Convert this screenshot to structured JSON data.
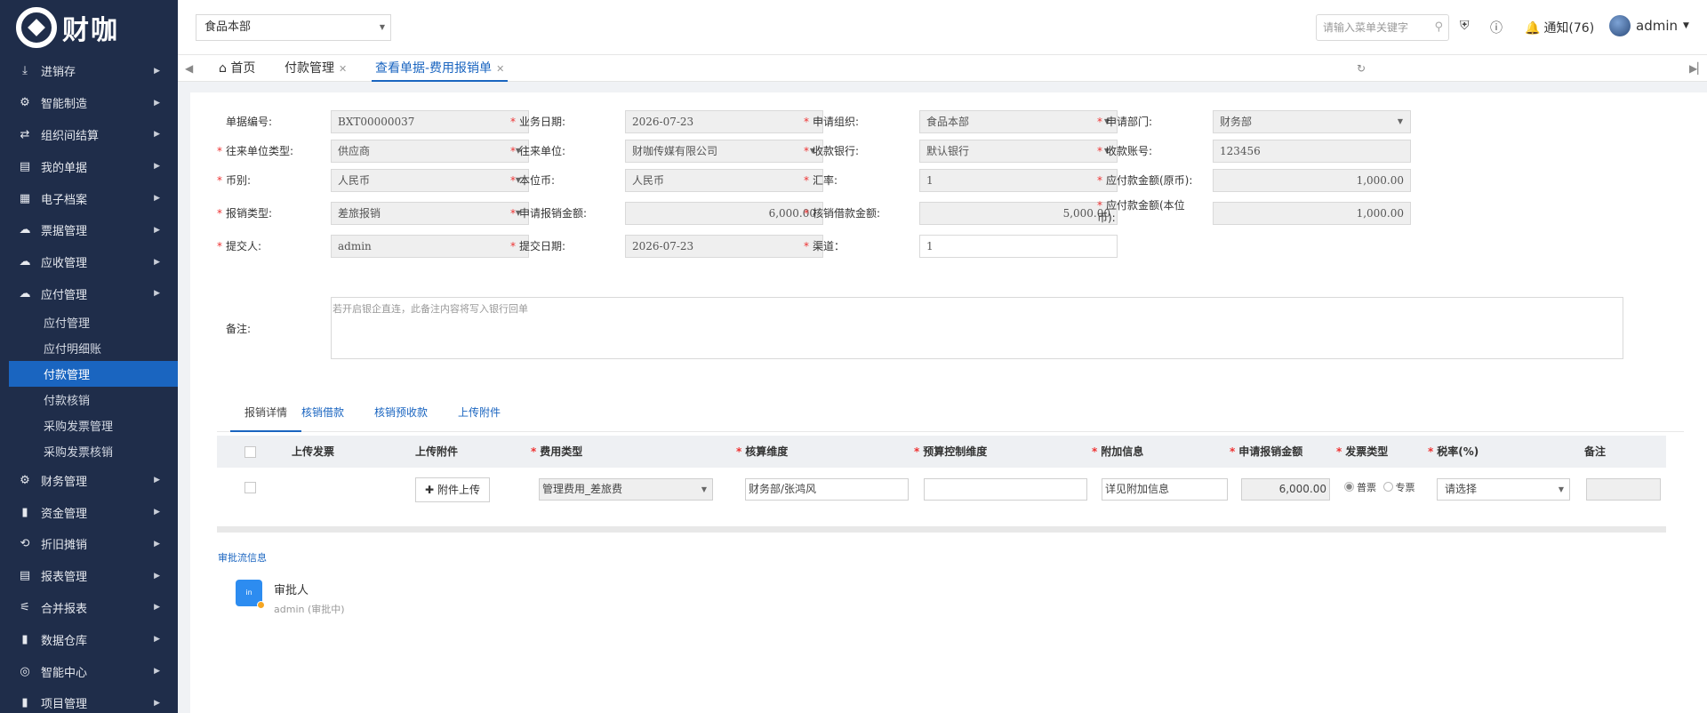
{
  "brand": {
    "name": "财咖"
  },
  "sidebar": {
    "items": [
      {
        "label": "进销存",
        "icon": "download-icon"
      },
      {
        "label": "智能制造",
        "icon": "gears-icon"
      },
      {
        "label": "组织间结算",
        "icon": "exchange-icon"
      },
      {
        "label": "我的单据",
        "icon": "document-icon"
      },
      {
        "label": "电子档案",
        "icon": "archive-icon"
      },
      {
        "label": "票据管理",
        "icon": "cloud-upload-icon"
      },
      {
        "label": "应收管理",
        "icon": "cloud-upload-icon"
      },
      {
        "label": "应付管理",
        "icon": "cloud-download-icon"
      }
    ],
    "sub_items": [
      {
        "label": "应付管理"
      },
      {
        "label": "应付明细账"
      },
      {
        "label": "付款管理"
      },
      {
        "label": "付款核销"
      },
      {
        "label": "采购发票管理"
      },
      {
        "label": "采购发票核销"
      }
    ],
    "items_after": [
      {
        "label": "财务管理",
        "icon": "gear-icon"
      },
      {
        "label": "资金管理",
        "icon": "bar-chart-icon"
      },
      {
        "label": "折旧摊销",
        "icon": "repeat-icon"
      },
      {
        "label": "报表管理",
        "icon": "report-icon"
      },
      {
        "label": "合并报表",
        "icon": "merge-icon"
      },
      {
        "label": "数据仓库",
        "icon": "bar-chart-icon"
      },
      {
        "label": "智能中心",
        "icon": "globe-icon"
      },
      {
        "label": "项目管理",
        "icon": "bar-chart-icon"
      }
    ]
  },
  "header": {
    "org": "食品本部",
    "search_placeholder": "请输入菜单关键字",
    "notice": "通知(76)",
    "user": "admin"
  },
  "tabs": [
    {
      "label": "首页"
    },
    {
      "label": "付款管理"
    },
    {
      "label": "查看单据-费用报销单"
    }
  ],
  "form": {
    "doc_no": {
      "label": "单据编号:",
      "value": "BXT00000037"
    },
    "biz_date": {
      "label": "业务日期:",
      "value": "2026-07-23"
    },
    "apply_org": {
      "label": "申请组织:",
      "value": "食品本部"
    },
    "apply_dept": {
      "label": "申请部门:",
      "value": "财务部"
    },
    "partner_type": {
      "label": "往来单位类型:",
      "value": "供应商"
    },
    "partner": {
      "label": "往来单位:",
      "value": "财咖传媒有限公司"
    },
    "bank": {
      "label": "收款银行:",
      "value": "默认银行"
    },
    "account": {
      "label": "收款账号:",
      "value": "123456"
    },
    "currency": {
      "label": "币别:",
      "value": "人民币"
    },
    "local_currency": {
      "label": "本位币:",
      "value": "人民币"
    },
    "rate": {
      "label": "汇率:",
      "value": "1"
    },
    "payable_orig": {
      "label": "应付款金额(原币):",
      "value": "1,000.00"
    },
    "expense_type": {
      "label": "报销类型:",
      "value": "差旅报销"
    },
    "apply_amount": {
      "label": "申请报销金额:",
      "value": "6,000.00"
    },
    "offset_amount": {
      "label": "核销借款金额:",
      "value": "5,000.00"
    },
    "payable_local": {
      "label": "应付款金额(本位币):",
      "value": "1,000.00"
    },
    "submitter": {
      "label": "提交人:",
      "value": "admin"
    },
    "submit_date": {
      "label": "提交日期:",
      "value": "2026-07-23"
    },
    "channel": {
      "label": "渠道：",
      "value": "1"
    },
    "remark": {
      "label": "备注:",
      "placeholder": "若开启银企直连，此备注内容将写入银行回单"
    }
  },
  "detail_tabs": [
    {
      "label": "报销详情"
    },
    {
      "label": "核销借款"
    },
    {
      "label": "核销预收款"
    },
    {
      "label": "上传附件"
    }
  ],
  "grid": {
    "headers": [
      "上传发票",
      "上传附件",
      "费用类型",
      "核算维度",
      "预算控制维度",
      "附加信息",
      "申请报销金额",
      "发票类型",
      "税率(%)",
      "备注"
    ],
    "row": {
      "upload_btn": "附件上传",
      "expense_type": "管理费用_差旅费",
      "dimension": "财务部/张鸿风",
      "budget_dim": "",
      "extra": "详见附加信息",
      "amount": "6,000.00",
      "invoice_general": "普票",
      "invoice_special": "专票",
      "tax": "请选择",
      "remark": ""
    }
  },
  "approval": {
    "title": "审批流信息",
    "badge": "in",
    "role": "审批人",
    "status": "admin (审批中)"
  }
}
